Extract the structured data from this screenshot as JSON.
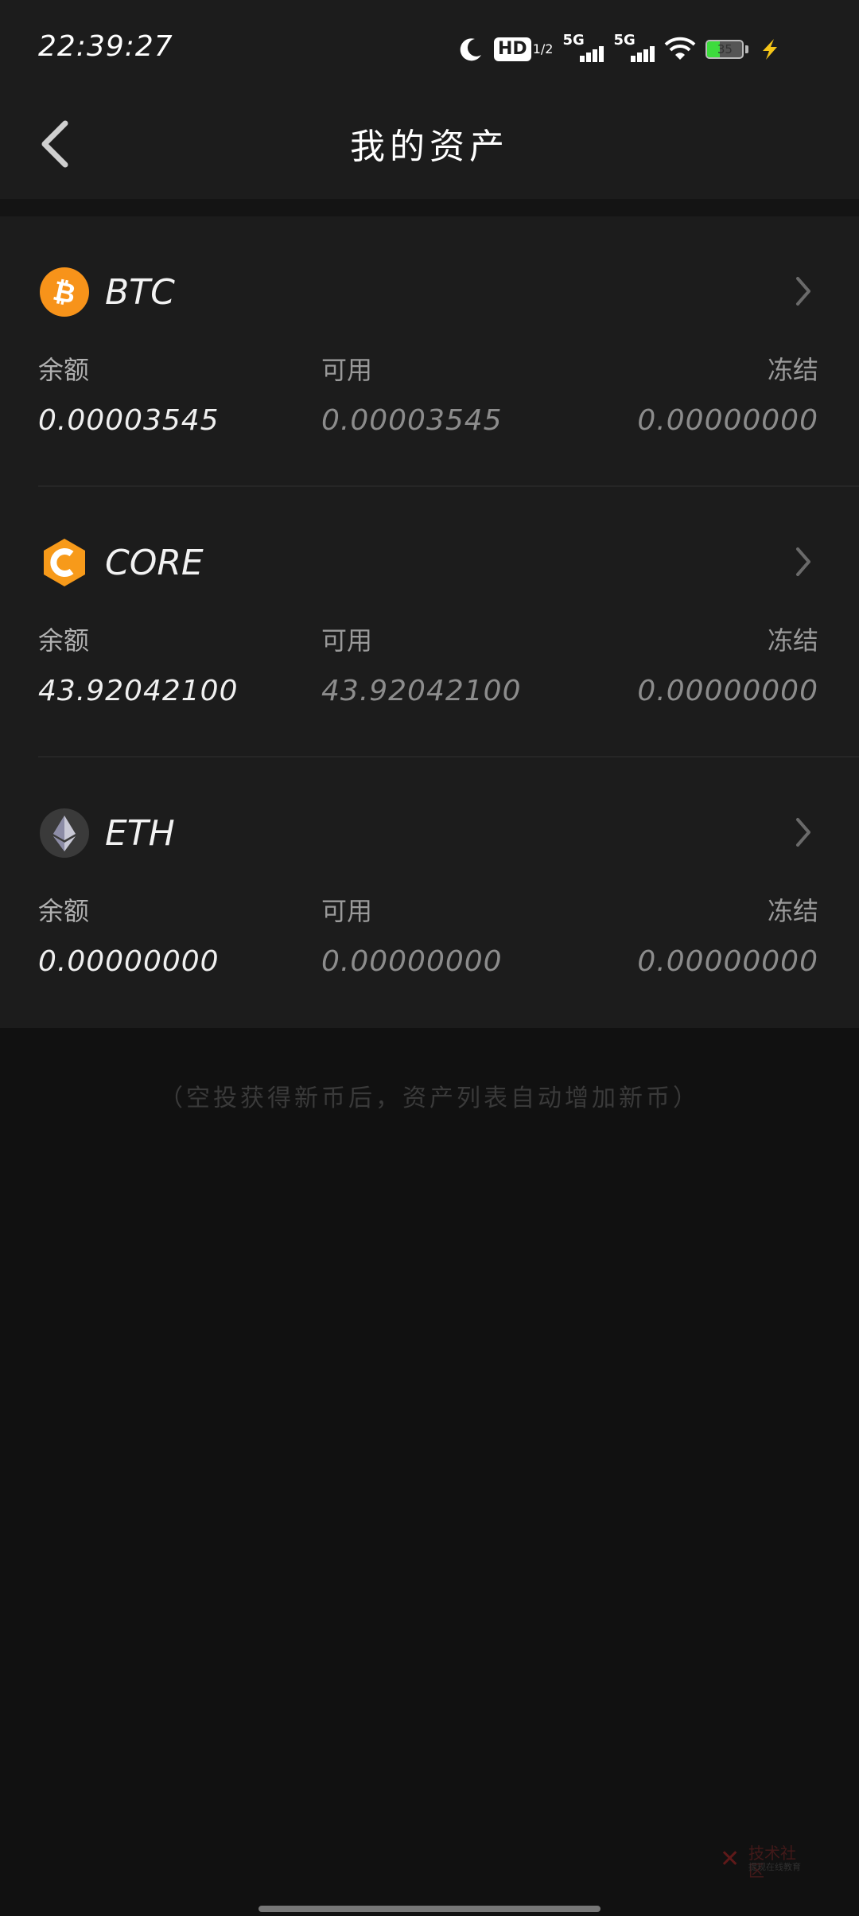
{
  "status_bar": {
    "time": "22:39:27",
    "hd_label": "HD",
    "hd_sub": "1/2",
    "sim1_label": "5G",
    "sim2_label": "5G",
    "battery_level": "35",
    "battery_color": "#3ddc3d",
    "charging_color": "#f5c518"
  },
  "header": {
    "title": "我的资产"
  },
  "labels": {
    "balance": "余额",
    "available": "可用",
    "frozen": "冻结"
  },
  "assets": [
    {
      "symbol": "BTC",
      "icon": "bitcoin-icon",
      "icon_color": "#f7931a",
      "balance": "0.00003545",
      "available": "0.00003545",
      "frozen": "0.00000000"
    },
    {
      "symbol": "CORE",
      "icon": "core-icon",
      "icon_color": "#f79a1a",
      "balance": "43.92042100",
      "available": "43.92042100",
      "frozen": "0.00000000"
    },
    {
      "symbol": "ETH",
      "icon": "ethereum-icon",
      "icon_color": "#3a3a3a",
      "balance": "0.00000000",
      "available": "0.00000000",
      "frozen": "0.00000000"
    }
  ],
  "footer_note": "（空投获得新币后，资产列表自动增加新币）",
  "watermark": {
    "text": "技术社区",
    "sub": "提现在线教育"
  }
}
